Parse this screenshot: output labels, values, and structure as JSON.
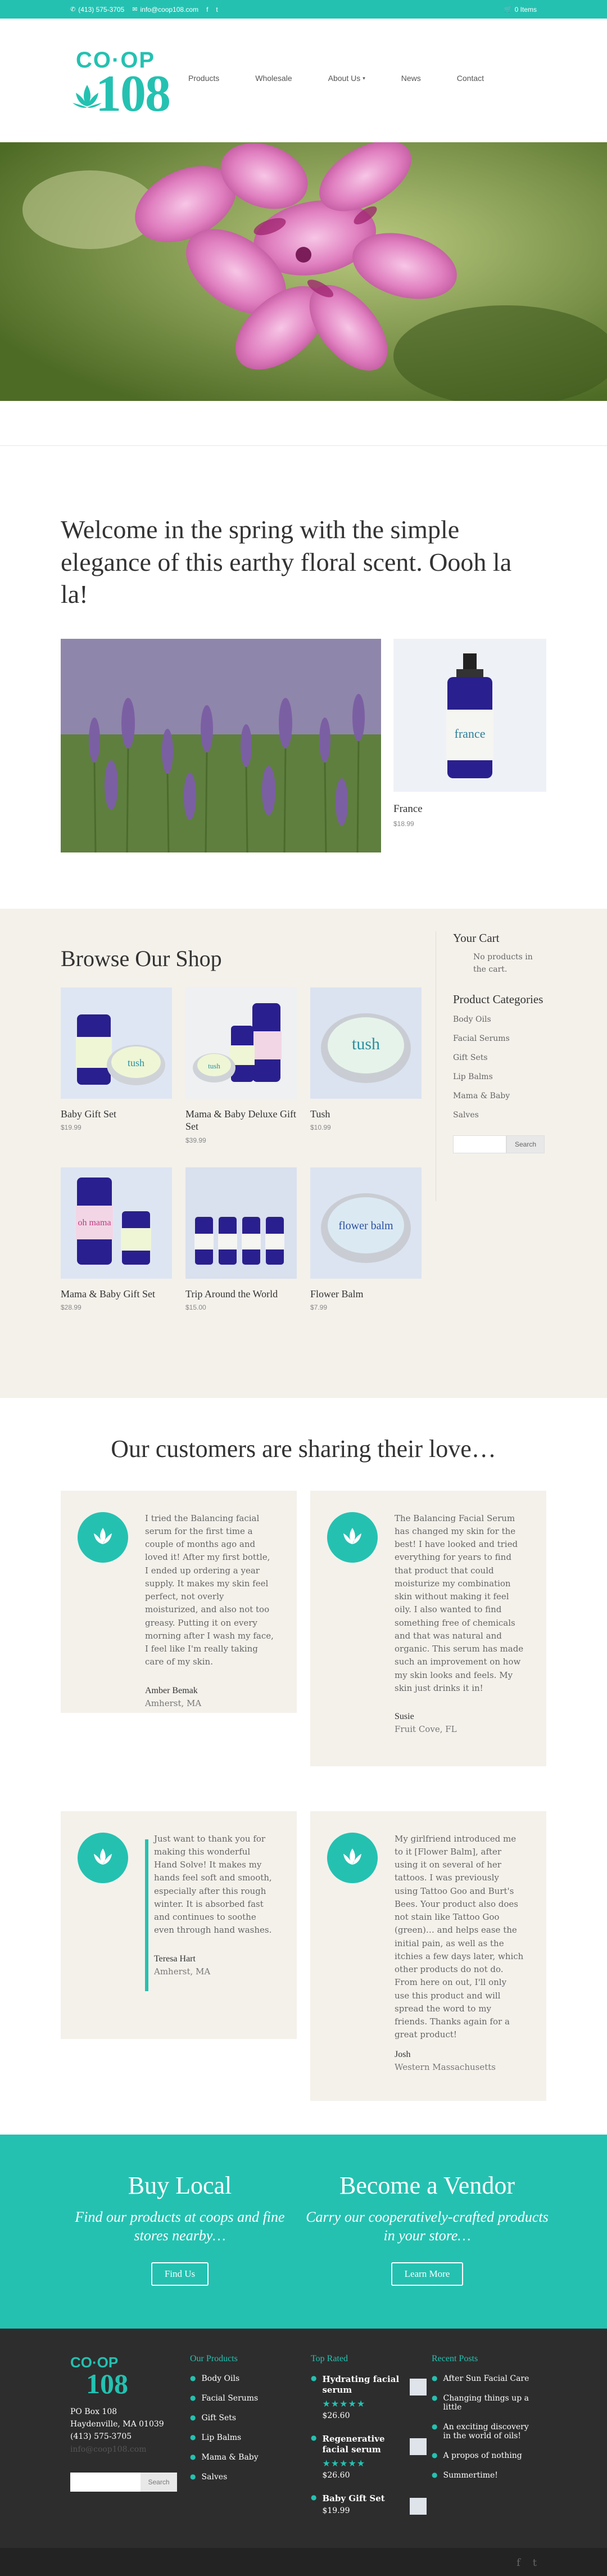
{
  "topbar": {
    "phone": "(413) 575-3705",
    "email": "info@coop108.com",
    "facebook": "f",
    "twitter": "t",
    "cart": "0 Items"
  },
  "header": {
    "logo_top": "CO·OP",
    "logo_num": "108",
    "nav": [
      "Products",
      "Wholesale",
      "About Us",
      "News",
      "Contact"
    ]
  },
  "feature": {
    "headline": "Welcome in the spring with the simple elegance of this earthy floral scent. Oooh la la!",
    "product_label": "france",
    "product_name": "France",
    "product_price": "$18.99"
  },
  "shop": {
    "title": "Browse Our Shop",
    "products": [
      {
        "name": "Baby Gift Set",
        "price": "$19.99",
        "bg": "#dfe6f3"
      },
      {
        "name": "Mama & Baby Deluxe Gift Set",
        "price": "$39.99",
        "bg": "#eef0f2"
      },
      {
        "name": "Tush",
        "price": "$10.99",
        "bg": "#dbe3f1"
      },
      {
        "name": "Mama & Baby Gift Set",
        "price": "$28.99",
        "bg": "#dee5f2"
      },
      {
        "name": "Trip Around the World",
        "price": "$15.00",
        "bg": "#d9e0ee"
      },
      {
        "name": "Flower Balm",
        "price": "$7.99",
        "bg": "#dde4f1"
      }
    ],
    "cart_title": "Your Cart",
    "cart_empty": "No products in the cart.",
    "categories_title": "Product Categories",
    "categories": [
      "Body Oils",
      "Facial Serums",
      "Gift Sets",
      "Lip Balms",
      "Mama & Baby",
      "Salves"
    ],
    "search_button": "Search"
  },
  "testimonials": {
    "title": "Our customers are sharing their love…",
    "items": [
      {
        "quote": "I tried the Balancing facial serum for the first time a couple of months ago and loved it! After my first bottle, I ended up ordering a year supply. It makes my skin feel perfect, not overly moisturized, and also not too greasy. Putting it on every morning after I wash my face, I feel like I'm really taking care of my skin.",
        "author": "Amber Bemak",
        "location": "Amherst, MA"
      },
      {
        "quote": "The Balancing Facial Serum has changed my skin for the best! I have looked and tried everything for years to find that product that could moisturize my combination skin without making it feel oily. I also wanted to find something free of chemicals and that was natural and organic. This serum has made such an improvement on how my skin looks and feels. My skin just drinks it in!",
        "author": "Susie",
        "location": "Fruit Cove, FL"
      },
      {
        "quote": "Just want to thank you for making this wonderful Hand Solve! It makes my hands feel soft and smooth, especially after this rough winter. It is absorbed fast and continues to soothe even through hand washes.",
        "author": "Teresa Hart",
        "location": "Amherst, MA"
      },
      {
        "quote": "My girlfriend introduced me to it [Flower Balm], after using it on several of her tattoos. I was previously using Tattoo Goo and Burt's Bees. Your product also does not stain like Tattoo Goo (green)… and helps ease the initial pain, as well as the itchies a few days later, which other products do not do. From here on out, I'll only use this product and will spread the word to my friends. Thanks again for a great product!",
        "author": "Josh",
        "location": "Western Massachusetts"
      }
    ]
  },
  "cta": {
    "left_title": "Buy Local",
    "left_sub": "Find our products at coops and fine stores nearby…",
    "left_button": "Find Us",
    "right_title": "Become a Vendor",
    "right_sub": "Carry our cooperatively-crafted products in your store…",
    "right_button": "Learn More"
  },
  "footer": {
    "logo_top": "CO·OP",
    "logo_num": "108",
    "address": [
      "PO Box 108",
      "Haydenville, MA 01039",
      "(413) 575-3705"
    ],
    "email": "info@coop108.com",
    "search_button": "Search",
    "products_title": "Our Products",
    "products": [
      "Body Oils",
      "Facial Serums",
      "Gift Sets",
      "Lip Balms",
      "Mama & Baby",
      "Salves"
    ],
    "rated_title": "Top Rated",
    "rated": [
      {
        "name": "Hydrating facial serum",
        "stars": "★★★★★",
        "price": "$26.60"
      },
      {
        "name": "Regenerative facial serum",
        "stars": "★★★★★",
        "price": "$26.60"
      },
      {
        "name": "Baby Gift Set",
        "stars": "",
        "price": "$19.99"
      }
    ],
    "posts_title": "Recent Posts",
    "posts": [
      "After Sun Facial Care",
      "Changing things up a little",
      "An exciting discovery in the world of oils!",
      "A propos of nothing",
      "Summertime!"
    ],
    "social": [
      "f",
      "t"
    ]
  },
  "colors": {
    "accent": "#24c1b1",
    "cream": "#f4f1eb",
    "footer": "#2d2d2d"
  }
}
